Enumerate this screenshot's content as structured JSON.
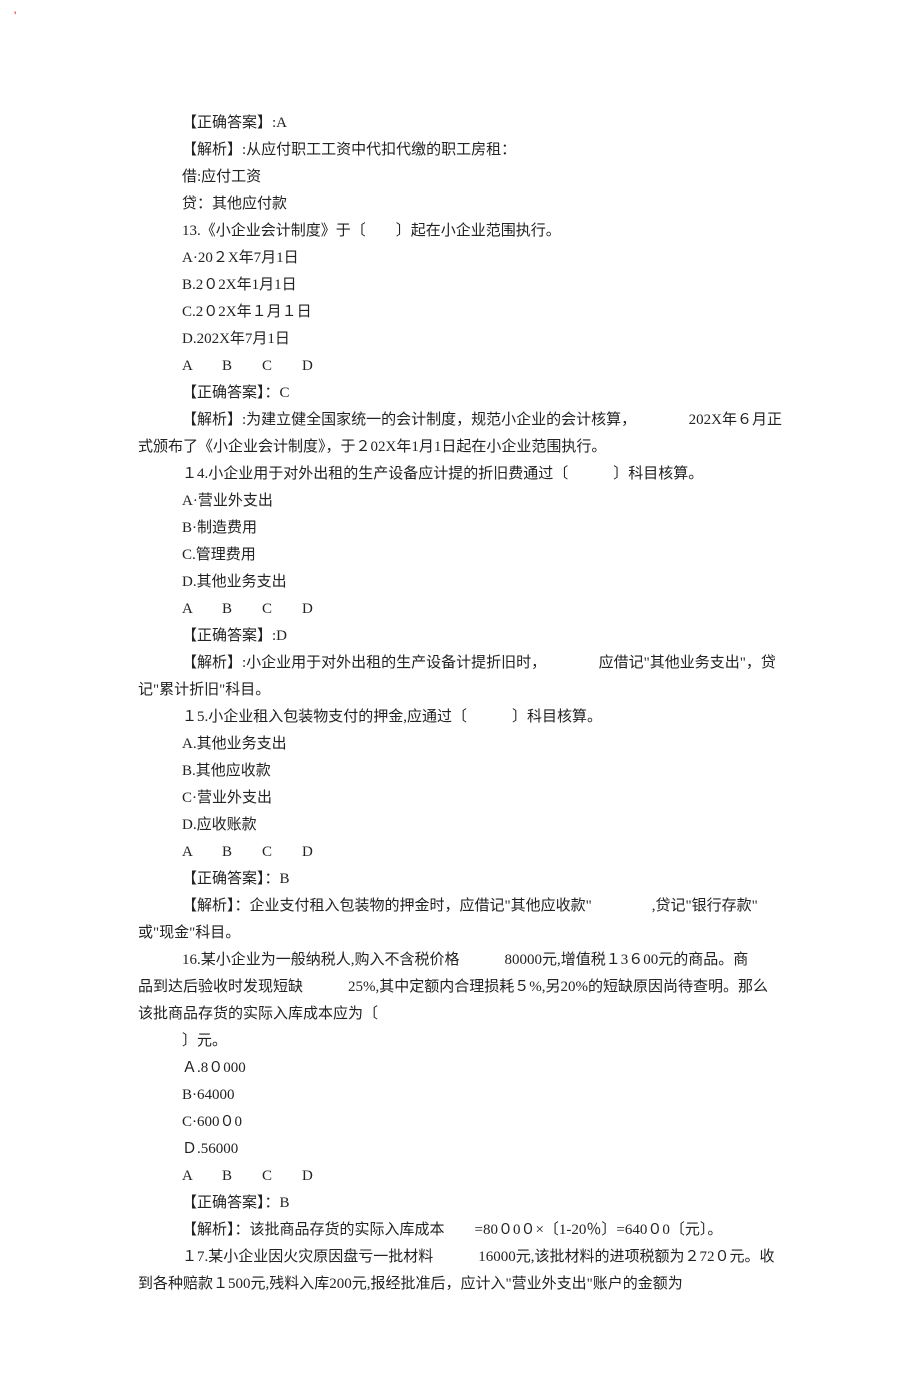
{
  "tick": "'",
  "q12": {
    "answer_label": "【正确答案】:A",
    "analysis_label": "【解析】:从应付职工工资中代扣代缴的职工房租：",
    "line_debit": "借:应付工资",
    "line_credit": "贷：其他应付款"
  },
  "q13": {
    "stem": "13.《小企业会计制度》于〔　　〕起在小企业范围执行。",
    "A": "A·20２X年7月1日",
    "B": "B.2０2X年1月1日",
    "C": "C.2０2X年１月１日",
    "D": "D.202X年7月1日",
    "abcd": "A　　B　　C　　D",
    "answer_label": "【正确答案】：C",
    "analysis1": "【解析】:为建立健全国家统一的会计制度，规范小企业的会计核算，　　　　202X年６月正",
    "analysis2": "式颁布了《小企业会计制度》，于２02X年1月1日起在小企业范围执行。"
  },
  "q14": {
    "stem": "１4.小企业用于对外出租的生产设备应计提的折旧费通过〔　　　〕科目核算。",
    "A": "A·营业外支出",
    "B": "B·制造费用",
    "C": "C.管理费用",
    "D": "D.其他业务支出",
    "abcd": "A　　B　　C　　D",
    "answer_label": "【正确答案】:D",
    "analysis1": "【解析】:小企业用于对外出租的生产设备计提折旧时，　　　　应借记\"其他业务支出\"，贷",
    "analysis2": "记\"累计折旧\"科目。"
  },
  "q15": {
    "stem": "１5.小企业租入包装物支付的押金,应通过〔　　　〕科目核算。",
    "A": "A.其他业务支出",
    "B": "B.其他应收款",
    "C": "C·营业外支出",
    "D": "D.应收账款",
    "abcd": "A　　B　　C　　D",
    "answer_label": "【正确答案】：B",
    "analysis1": "【解析】：企业支付租入包装物的押金时，应借记\"其他应收款\"　　　　,贷记\"银行存款\"",
    "analysis2": "或\"现金\"科目。"
  },
  "q16": {
    "stem1": "16.某小企业为一般纳税人,购入不含税价格　　　80000元,增值税１3６00元的商品。商",
    "stem2": "品到达后验收时发现短缺　　　25%,其中定额内合理损耗５%,另20%的短缺原因尚待查明。那么",
    "stem3": "该批商品存货的实际入库成本应为〔",
    "stem4": "〕元。",
    "A": "Ａ.8０000",
    "B": "B·64000",
    "C": "C·600０0",
    "D": "Ｄ.56000",
    "abcd": "A　　B　　C　　D",
    "answer_label": "【正确答案】：B",
    "analysis": "【解析】：该批商品存货的实际入库成本　　=80０0０×〔1-20％〕=640０0〔元〕。"
  },
  "q17": {
    "stem1": "１7.某小企业因火灾原因盘亏一批材料　　　16000元,该批材料的进项税额为２72０元。收",
    "stem2": "到各种赔款１500元,残料入库200元,报经批准后，应计入\"营业外支出\"账户的金额为"
  }
}
